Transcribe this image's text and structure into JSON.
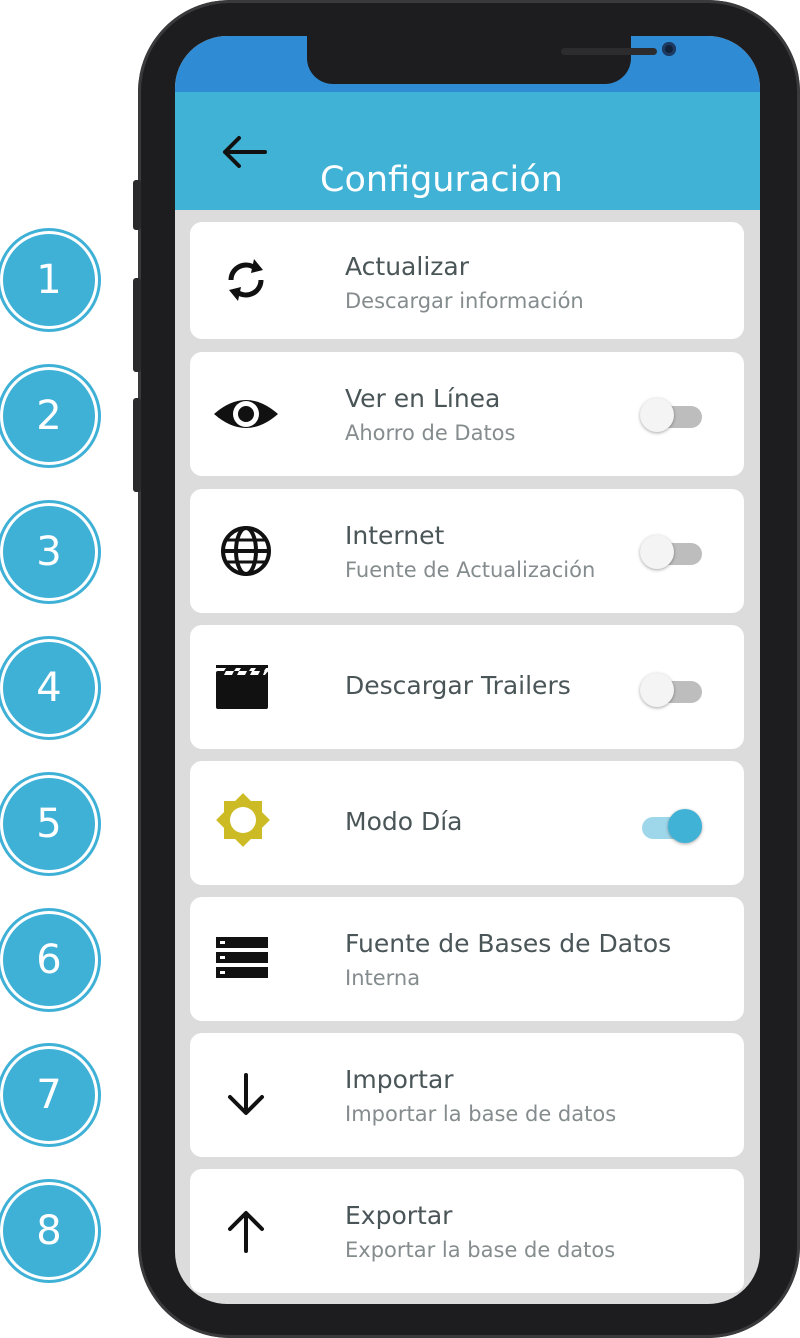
{
  "callouts": [
    "1",
    "2",
    "3",
    "4",
    "5",
    "6",
    "7",
    "8"
  ],
  "appbar": {
    "title": "Configuración",
    "back_icon": "arrow-left-icon",
    "color": "#3fb2d6"
  },
  "status_color": "#2f8bd3",
  "settings": [
    {
      "title": "Actualizar",
      "subtitle": "Descargar información",
      "icon": "sync-icon"
    },
    {
      "title": "Ver en Línea",
      "subtitle": "Ahorro de Datos",
      "icon": "eye-icon",
      "toggle": false
    },
    {
      "title": "Internet",
      "subtitle": "Fuente de Actualización",
      "icon": "globe-icon",
      "toggle": false
    },
    {
      "title": "Descargar Trailers",
      "icon": "clapperboard-icon",
      "toggle": false
    },
    {
      "title": "Modo Día",
      "icon": "sun-icon",
      "toggle": true
    },
    {
      "title": "Fuente de Bases de Datos",
      "subtitle": "Interna",
      "icon": "database-icon"
    },
    {
      "title": "Importar",
      "subtitle": "Importar la base de datos",
      "icon": "arrow-down-icon"
    },
    {
      "title": "Exportar",
      "subtitle": "Exportar la base de datos",
      "icon": "arrow-up-icon"
    }
  ],
  "colors": {
    "accent": "#3fb2d6",
    "sun": "#cdbb25",
    "toggle_on_track": "#9fd7ea",
    "toggle_off_track": "#bdbdbd"
  }
}
